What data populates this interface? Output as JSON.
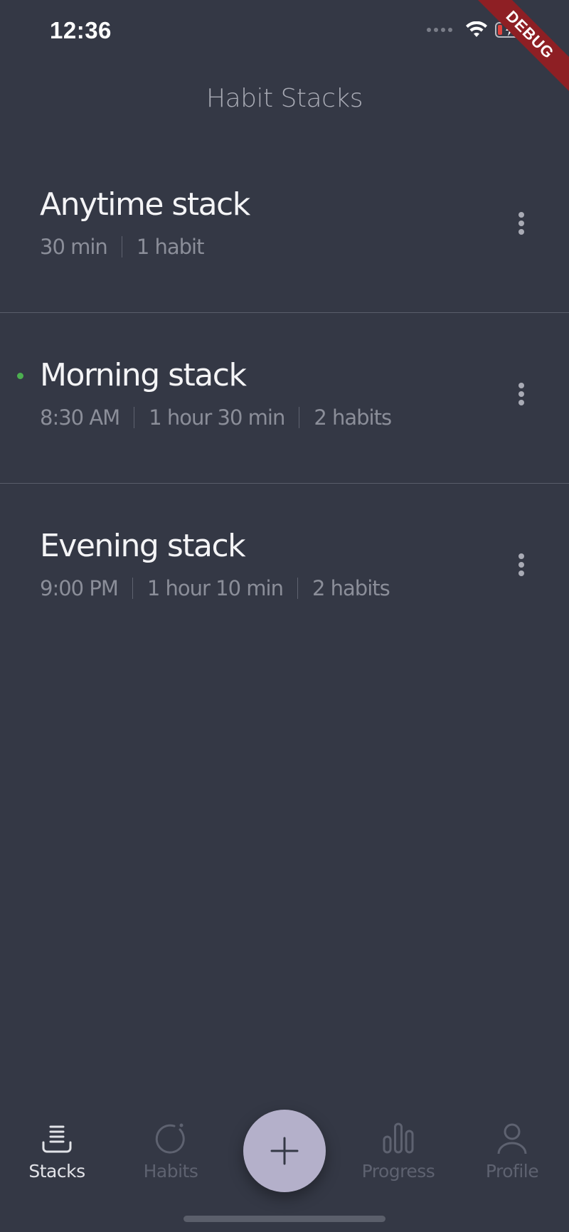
{
  "status_bar": {
    "time": "12:36",
    "debug_label": "DEBUG",
    "icons": [
      "signal-icon",
      "wifi-icon",
      "battery-charging-icon"
    ]
  },
  "header": {
    "title": "Habit Stacks"
  },
  "stacks": [
    {
      "name": "Anytime stack",
      "meta": [
        "30 min",
        "1 habit"
      ],
      "active": false
    },
    {
      "name": "Morning stack",
      "meta": [
        "8:30 AM",
        "1 hour 30 min",
        "2 habits"
      ],
      "active": true
    },
    {
      "name": "Evening stack",
      "meta": [
        "9:00 PM",
        "1 hour 10 min",
        "2 habits"
      ],
      "active": false
    }
  ],
  "bottom_nav": {
    "items": [
      {
        "label": "Stacks",
        "icon": "stacks-icon",
        "active": true
      },
      {
        "label": "Habits",
        "icon": "habits-icon",
        "active": false
      },
      {
        "label": "Progress",
        "icon": "progress-icon",
        "active": false
      },
      {
        "label": "Profile",
        "icon": "profile-icon",
        "active": false
      }
    ],
    "fab_icon": "plus-icon"
  },
  "colors": {
    "background": "#343845",
    "active_indicator": "#4caf50",
    "fab": "#b4b0ca",
    "debug_ribbon": "#8e1f24"
  }
}
